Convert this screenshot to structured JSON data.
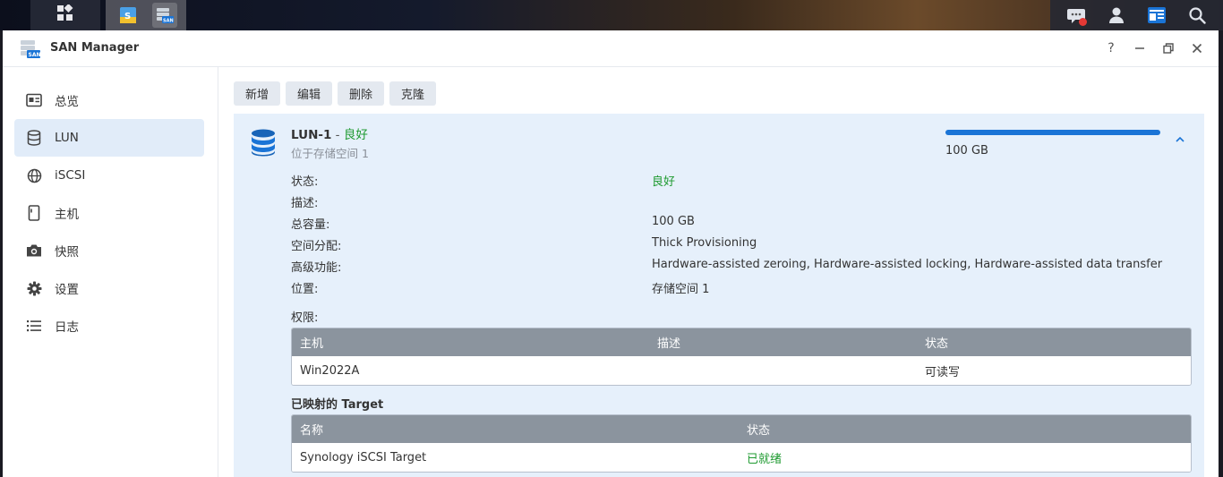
{
  "app": {
    "title": "SAN Manager"
  },
  "window_controls": {
    "help": "?",
    "minimize": "—",
    "restore": "❐",
    "close": "✕"
  },
  "sidebar": {
    "items": [
      {
        "label": "总览",
        "icon": "overview-icon",
        "active": false
      },
      {
        "label": "LUN",
        "icon": "database-icon",
        "active": true
      },
      {
        "label": "iSCSI",
        "icon": "globe-icon",
        "active": false
      },
      {
        "label": "主机",
        "icon": "host-icon",
        "active": false
      },
      {
        "label": "快照",
        "icon": "camera-icon",
        "active": false
      },
      {
        "label": "设置",
        "icon": "gear-icon",
        "active": false
      },
      {
        "label": "日志",
        "icon": "list-icon",
        "active": false
      }
    ]
  },
  "toolbar": {
    "add": "新增",
    "edit": "编辑",
    "delete": "删除",
    "clone": "克隆"
  },
  "lun": {
    "name": "LUN-1",
    "separator": " - ",
    "status": "良好",
    "location_line": "位于存储空间 1",
    "capacity_text": "100 GB",
    "capacity_fill": 1.0,
    "details": [
      {
        "label": "状态:",
        "value": "良好",
        "ok": true
      },
      {
        "label": "描述:",
        "value": "",
        "ok": false
      },
      {
        "label": "总容量:",
        "value": "100 GB",
        "ok": false
      },
      {
        "label": "空间分配:",
        "value": "Thick Provisioning",
        "ok": false
      },
      {
        "label": "高级功能:",
        "value": "Hardware-assisted zeroing, Hardware-assisted locking, Hardware-assisted data transfer",
        "ok": false
      },
      {
        "label": "位置:",
        "value": "存储空间 1",
        "ok": false
      }
    ],
    "permissions_label": "权限:",
    "permissions_table": {
      "headers": [
        "主机",
        "描述",
        "状态"
      ],
      "rows": [
        [
          "Win2022A",
          "",
          "可读写"
        ]
      ]
    },
    "mapped_label": "已映射的 Target",
    "target_table": {
      "headers": [
        "名称",
        "状态"
      ],
      "rows": [
        [
          "Synology iSCSI Target",
          "已就绪"
        ]
      ]
    }
  },
  "colors": {
    "accent": "#1a74d6",
    "ok": "#1e9a30",
    "panel": "#e6f0fb",
    "table_header": "#8b949e"
  }
}
